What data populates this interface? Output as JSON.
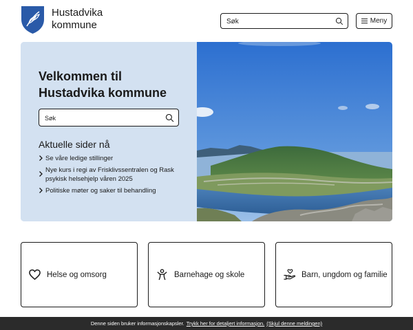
{
  "header": {
    "logo_line1": "Hustadvika",
    "logo_line2": "kommune",
    "logo_icon": "municipal-coat-of-arms",
    "search_placeholder": "Søk",
    "menu_label": "Meny"
  },
  "hero": {
    "title_line1": "Velkommen til",
    "title_line2": "Hustadvika kommune",
    "search_placeholder": "Søk",
    "current_title": "Aktuelle sider nå",
    "links": [
      "Se våre ledige stillinger",
      "Nye kurs i regi av Frisklivssentralen og Rask psykisk helsehjelp våren 2025",
      "Politiske møter og saker til behandling"
    ]
  },
  "cards": [
    {
      "label": "Helse og omsorg",
      "icon": "heart-icon"
    },
    {
      "label": "Barnehage og skole",
      "icon": "child-icon"
    },
    {
      "label": "Barn, ungdom og familie",
      "icon": "hand-heart-icon"
    }
  ],
  "cookie": {
    "text": "Denne siden bruker informasjonskapsler.",
    "more_link": "Trykk her for detaljert informasjon.",
    "dismiss_link": "(Skjul denne meldingen)"
  },
  "colors": {
    "hero_panel": "#d3e1f1",
    "logo_blue": "#2a5aa8",
    "cookie_bg": "#2b2b2b"
  }
}
